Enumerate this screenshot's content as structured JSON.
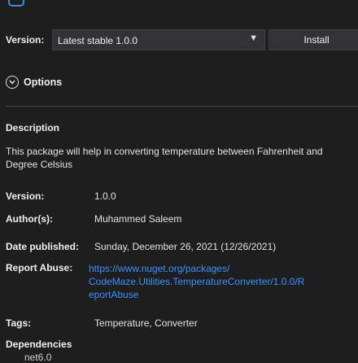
{
  "header": {
    "version_label": "Version:",
    "version_selected": "Latest stable 1.0.0",
    "install_label": "Install"
  },
  "options": {
    "label": "Options"
  },
  "description": {
    "title": "Description",
    "text": "This package will help in converting temperature between Fahrenheit and Degree Celsius"
  },
  "details": {
    "version_key": "Version:",
    "version_value": "1.0.0",
    "authors_key": "Author(s):",
    "authors_value": "Muhammed Saleem",
    "date_key": "Date published:",
    "date_value": "Sunday, December 26, 2021 (12/26/2021)",
    "report_key": "Report Abuse:",
    "report_value": "https://www.nuget.org/packages/CodeMaze.Utilities.TemperatureConverter/1.0.0/ReportAbuse",
    "tags_key": "Tags:",
    "tags_value": "Temperature, Converter"
  },
  "dependencies": {
    "title": "Dependencies",
    "item": "net6.0"
  },
  "colors": {
    "background": "#1e1e1e",
    "link": "#3794ff",
    "accent": "#3b8bd8"
  }
}
